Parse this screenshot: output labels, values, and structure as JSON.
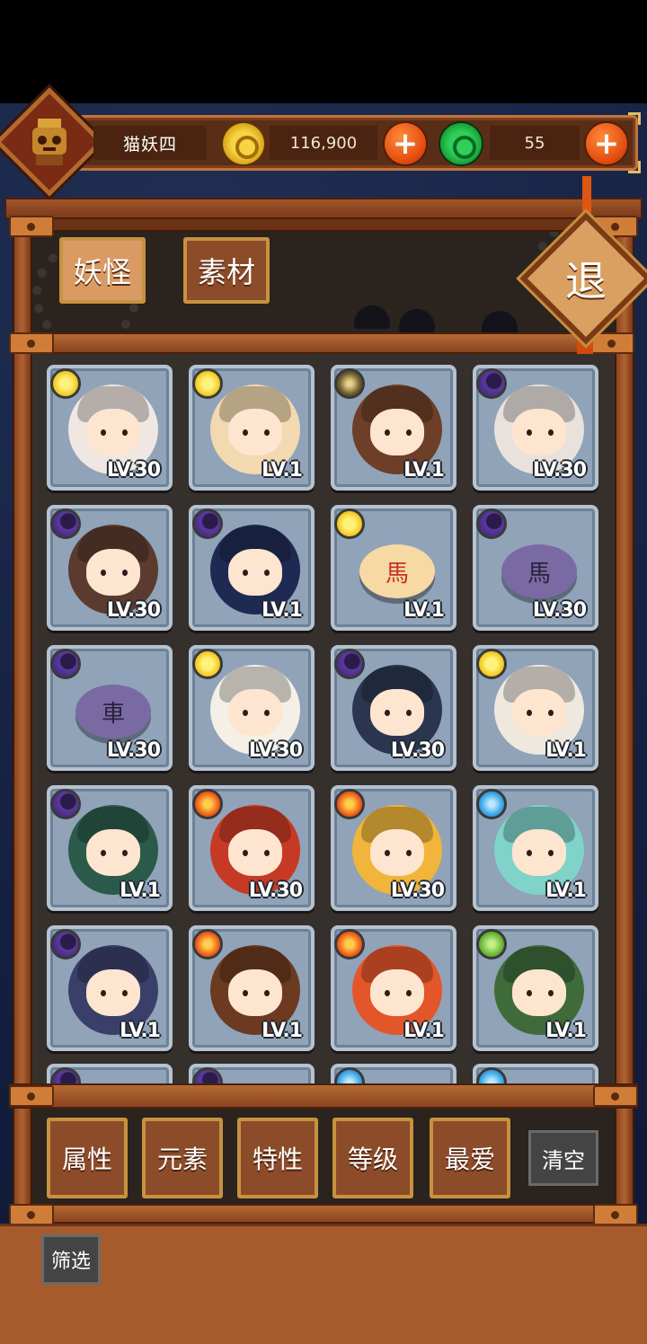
{
  "player": {
    "name": "猫妖四"
  },
  "currency": {
    "coins": "116,900",
    "gems": "55",
    "add_symbol": "+"
  },
  "tabs": [
    {
      "label": "妖怪",
      "active": true
    },
    {
      "label": "素材",
      "active": false
    }
  ],
  "exit_label": "退",
  "cards": [
    {
      "element": "sun",
      "level": "LV.30",
      "kind": "beast",
      "color": "#f1e7e2"
    },
    {
      "element": "sun",
      "level": "LV.1",
      "kind": "hero",
      "color": "#f3d9b0"
    },
    {
      "element": "earth",
      "level": "LV.1",
      "kind": "hero",
      "color": "#6d3e28"
    },
    {
      "element": "moon",
      "level": "LV.30",
      "kind": "hero",
      "color": "#e9e2dc"
    },
    {
      "element": "moon",
      "level": "LV.30",
      "kind": "hero",
      "color": "#5a3b2e"
    },
    {
      "element": "moon",
      "level": "LV.1",
      "kind": "hero",
      "color": "#1f2a52"
    },
    {
      "element": "sun",
      "level": "LV.1",
      "kind": "chess",
      "chess_char": "馬",
      "color": "#f7d9a4"
    },
    {
      "element": "moon",
      "level": "LV.30",
      "kind": "chess",
      "chess_char": "馬",
      "color": "#7a6aa3"
    },
    {
      "element": "moon",
      "level": "LV.30",
      "kind": "chess",
      "chess_char": "車",
      "color": "#7a6aa3"
    },
    {
      "element": "sun",
      "level": "LV.30",
      "kind": "hero",
      "color": "#f4f0e6"
    },
    {
      "element": "moon",
      "level": "LV.30",
      "kind": "hero",
      "color": "#2b3550"
    },
    {
      "element": "sun",
      "level": "LV.1",
      "kind": "hero",
      "color": "#efe8df"
    },
    {
      "element": "moon",
      "level": "LV.1",
      "kind": "hero",
      "color": "#2c5a4a"
    },
    {
      "element": "fire",
      "level": "LV.30",
      "kind": "hero",
      "color": "#c63a25"
    },
    {
      "element": "fire",
      "level": "LV.30",
      "kind": "hero",
      "color": "#f0b53a"
    },
    {
      "element": "water",
      "level": "LV.1",
      "kind": "hero",
      "color": "#7fd3c9"
    },
    {
      "element": "moon",
      "level": "LV.1",
      "kind": "hero",
      "color": "#3a3f6a"
    },
    {
      "element": "fire",
      "level": "LV.1",
      "kind": "hero",
      "color": "#6b3a20"
    },
    {
      "element": "fire",
      "level": "LV.1",
      "kind": "hero",
      "color": "#e2562a"
    },
    {
      "element": "wood",
      "level": "LV.1",
      "kind": "hero",
      "color": "#3f6b3a"
    },
    {
      "element": "moon",
      "level": "",
      "kind": "partial",
      "color": "#4a4a5a"
    },
    {
      "element": "moon",
      "level": "",
      "kind": "partial",
      "color": "#4a4a5a"
    },
    {
      "element": "water",
      "level": "",
      "kind": "partial",
      "color": "#c89a3a"
    },
    {
      "element": "water",
      "level": "",
      "kind": "partial",
      "color": "#8fc0c8"
    }
  ],
  "filters": [
    {
      "label": "属性"
    },
    {
      "label": "元素"
    },
    {
      "label": "特性"
    },
    {
      "label": "等级"
    },
    {
      "label": "最爱"
    }
  ],
  "clear_label": "清空",
  "screen_label": "筛选",
  "colors": {
    "wood": "#a1542a",
    "accent_orange": "#e34d10",
    "coin": "#f2c418",
    "gem": "#18a03a",
    "card": "#90a3b8"
  }
}
